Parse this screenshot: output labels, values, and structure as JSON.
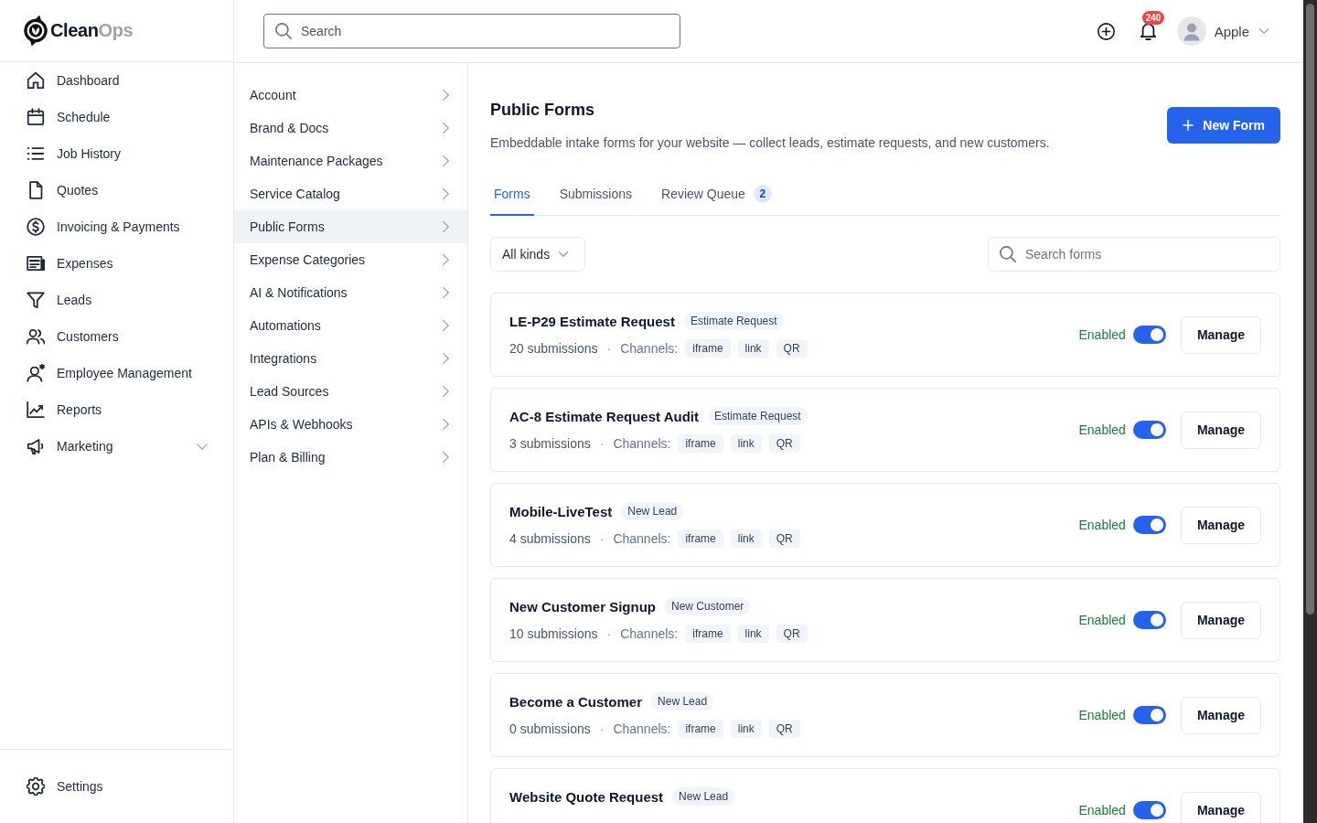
{
  "sidebar": {
    "logo": {
      "text": "Clean",
      "accent": "Ops"
    },
    "items": [
      {
        "label": "Dashboard",
        "kind": "link"
      },
      {
        "label": "Schedule",
        "kind": "link"
      },
      {
        "label": "Job History",
        "kind": "link"
      },
      {
        "label": "Quotes",
        "kind": "link"
      },
      {
        "label": "Invoicing & Payments",
        "kind": "link"
      },
      {
        "label": "Expenses",
        "kind": "link"
      },
      {
        "label": "Leads",
        "kind": "link"
      },
      {
        "label": "Customers",
        "kind": "link"
      },
      {
        "label": "Employee Management",
        "kind": "link"
      },
      {
        "label": "Reports",
        "kind": "link"
      },
      {
        "label": "Marketing",
        "kind": "group",
        "expanded": false
      }
    ],
    "footer_item": {
      "label": "Settings"
    }
  },
  "topbar": {
    "search": {
      "placeholder": "Search"
    },
    "notifications": {
      "count": "240"
    },
    "user": {
      "name": "Apple"
    }
  },
  "settings_menu": {
    "items": [
      {
        "label": "Account",
        "selected": false
      },
      {
        "label": "Brand & Docs",
        "selected": false
      },
      {
        "label": "Maintenance Packages",
        "selected": false
      },
      {
        "label": "Service Catalog",
        "selected": false
      },
      {
        "label": "Public Forms",
        "selected": true
      },
      {
        "label": "Expense Categories",
        "selected": false
      },
      {
        "label": "AI & Notifications",
        "selected": false
      },
      {
        "label": "Automations",
        "selected": false
      },
      {
        "label": "Integrations",
        "selected": false
      },
      {
        "label": "Lead Sources",
        "selected": false
      },
      {
        "label": "APIs & Webhooks",
        "selected": false
      },
      {
        "label": "Plan & Billing",
        "selected": false
      }
    ]
  },
  "page": {
    "title": "Public Forms",
    "description": "Embeddable intake forms for your website — collect leads, estimate requests, and new customers.",
    "primary_button": "New Form",
    "tabs": [
      {
        "label": "Forms",
        "selected": true
      },
      {
        "label": "Submissions",
        "selected": false
      },
      {
        "label": "Review Queue",
        "selected": false,
        "count": "2"
      }
    ],
    "filter": {
      "value": "All kinds"
    },
    "search": {
      "placeholder": "Search forms"
    },
    "forms": [
      {
        "name": "LE-P29 Estimate Request",
        "tag": "Estimate Request",
        "submissions": "20 submissions",
        "separator": "·",
        "channels_label": "Channels:",
        "channels": [
          "iframe",
          "link",
          "QR"
        ],
        "status": "Enabled",
        "enabled": true,
        "action": "Manage"
      },
      {
        "name": "AC-8 Estimate Request Audit",
        "tag": "Estimate Request",
        "submissions": "3 submissions",
        "separator": "·",
        "channels_label": "Channels:",
        "channels": [
          "iframe",
          "link",
          "QR"
        ],
        "status": "Enabled",
        "enabled": true,
        "action": "Manage"
      },
      {
        "name": "Mobile-LiveTest",
        "tag": "New Lead",
        "submissions": "4 submissions",
        "separator": "·",
        "channels_label": "Channels:",
        "channels": [
          "iframe",
          "link",
          "QR"
        ],
        "status": "Enabled",
        "enabled": true,
        "action": "Manage"
      },
      {
        "name": "New Customer Signup",
        "tag": "New Customer",
        "submissions": "10 submissions",
        "separator": "·",
        "channels_label": "Channels:",
        "channels": [
          "iframe",
          "link",
          "QR"
        ],
        "status": "Enabled",
        "enabled": true,
        "action": "Manage"
      },
      {
        "name": "Become a Customer",
        "tag": "New Lead",
        "submissions": "0 submissions",
        "separator": "·",
        "channels_label": "Channels:",
        "channels": [
          "iframe",
          "link",
          "QR"
        ],
        "status": "Enabled",
        "enabled": true,
        "action": "Manage"
      },
      {
        "name": "Website Quote Request",
        "tag": "New Lead",
        "status": "Enabled",
        "enabled": true,
        "action": "Manage"
      }
    ]
  }
}
